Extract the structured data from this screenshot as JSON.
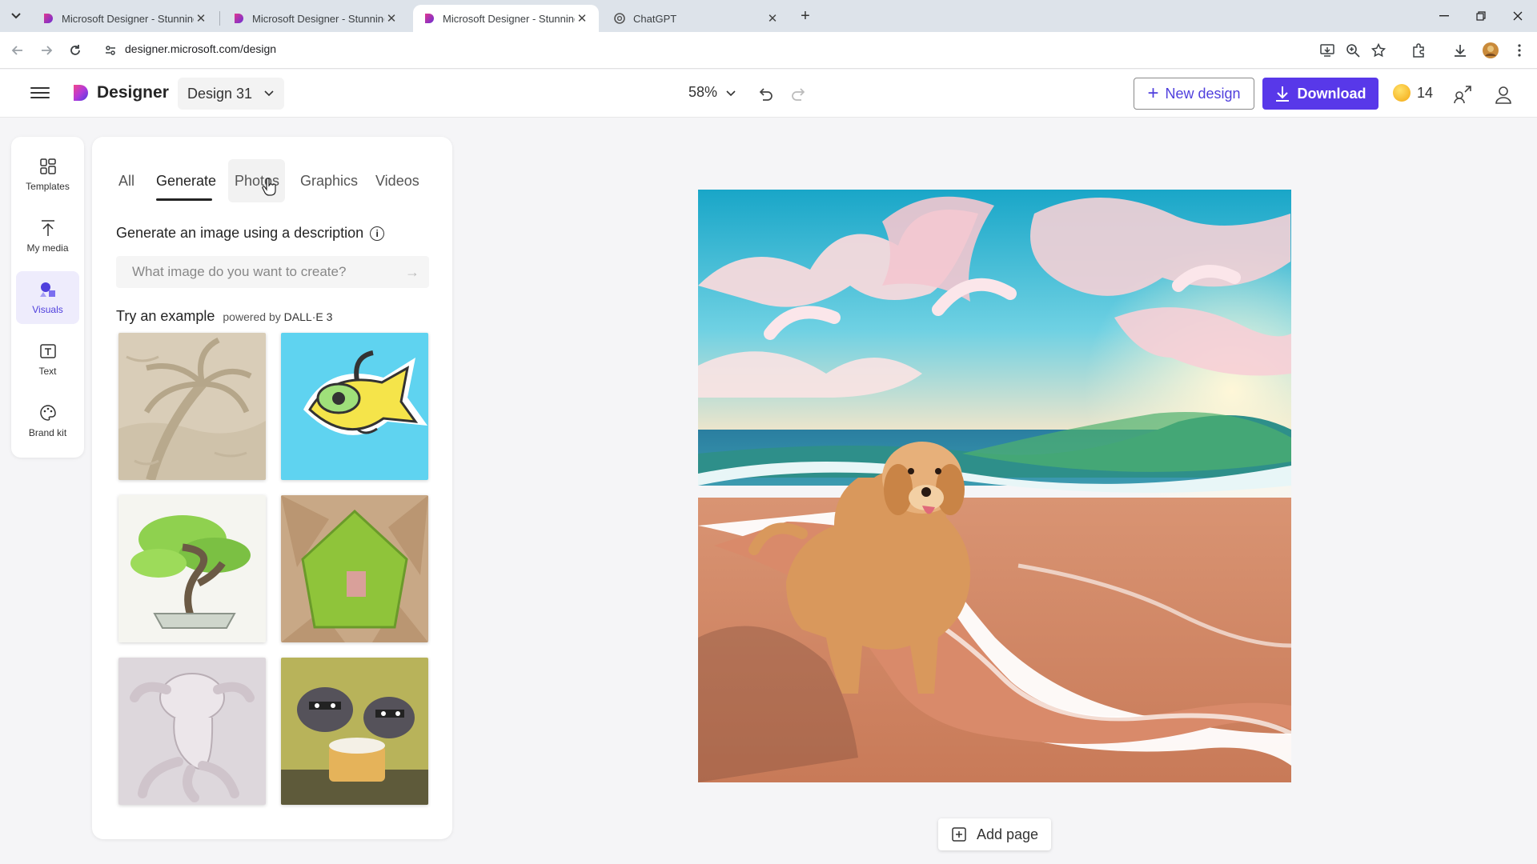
{
  "browser": {
    "tabs": [
      {
        "title": "Microsoft Designer - Stunning",
        "active": false
      },
      {
        "title": "Microsoft Designer - Stunning",
        "active": false
      },
      {
        "title": "Microsoft Designer - Stunning",
        "active": true
      },
      {
        "title": "ChatGPT",
        "active": false
      }
    ],
    "url": "designer.microsoft.com/design"
  },
  "header": {
    "brand": "Designer",
    "design_name": "Design 31",
    "zoom": "58%",
    "new_design_label": "New design",
    "download_label": "Download",
    "coins": "14",
    "accent_color": "#5838e9"
  },
  "rail": {
    "items": [
      {
        "label": "Templates",
        "icon": "templates-icon"
      },
      {
        "label": "My media",
        "icon": "upload-icon"
      },
      {
        "label": "Visuals",
        "icon": "visuals-icon",
        "active": true
      },
      {
        "label": "Text",
        "icon": "text-icon"
      },
      {
        "label": "Brand kit",
        "icon": "palette-icon"
      }
    ]
  },
  "panel": {
    "tabs": [
      "All",
      "Generate",
      "Photos",
      "Graphics",
      "Videos"
    ],
    "active_tab": "Generate",
    "generate_title": "Generate an image using a description",
    "prompt_placeholder": "What image do you want to create?",
    "try_example": "Try an example",
    "powered_by": "powered by",
    "model": "DALL·E 3",
    "examples": [
      {
        "name": "sand-palm-tree"
      },
      {
        "name": "fish-with-goggles-sticker"
      },
      {
        "name": "bonsai-tree"
      },
      {
        "name": "leaf-house"
      },
      {
        "name": "octopus-sculpture"
      },
      {
        "name": "raccoons-with-cake"
      }
    ]
  },
  "canvas": {
    "subject": "dog-on-beach-image"
  },
  "footer": {
    "add_page_label": "Add page"
  }
}
